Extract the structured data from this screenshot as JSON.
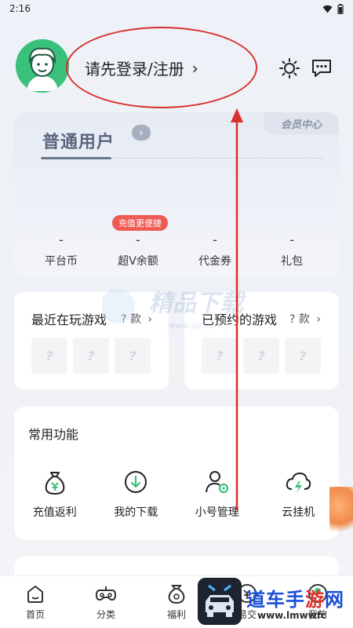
{
  "status_bar": {
    "time": "2:16"
  },
  "header": {
    "login_text": "请先登录/注册",
    "login_chevron": "›"
  },
  "member_card": {
    "level": "普通用户",
    "center_tab": "会员中心",
    "arrow": "›"
  },
  "recharge_badge": "充值更便捷",
  "stats": [
    {
      "value": "-",
      "label": "平台币"
    },
    {
      "value": "-",
      "label": "超V余额"
    },
    {
      "value": "-",
      "label": "代金券"
    },
    {
      "value": "-",
      "label": "礼包"
    }
  ],
  "recent_games": {
    "title": "最近在玩游戏",
    "count": "? 款",
    "chevron": "›"
  },
  "reserved_games": {
    "title": "已预约的游戏",
    "count": "? 款",
    "chevron": "›"
  },
  "slot_placeholder": "?",
  "watermark": {
    "text": "精品下载",
    "url": "www.jpj.com"
  },
  "functions": {
    "title": "常用功能",
    "items": [
      {
        "label": "充值返利",
        "icon": "money-bag-icon"
      },
      {
        "label": "我的下载",
        "icon": "download-icon"
      },
      {
        "label": "小号管理",
        "icon": "user-settings-icon"
      },
      {
        "label": "云挂机",
        "icon": "cloud-lightning-icon"
      }
    ]
  },
  "tabbar": [
    {
      "label": "首页",
      "icon": "home-icon"
    },
    {
      "label": "分类",
      "icon": "gamepad-icon"
    },
    {
      "label": "福利",
      "icon": "gift-bag-icon"
    },
    {
      "label": "易交",
      "icon": "trade-icon"
    },
    {
      "label": "我的",
      "icon": "profile-icon"
    }
  ],
  "overlay": {
    "brand_a": "道车手",
    "brand_b": "游",
    "brand_c": "网",
    "url": "www.lmwwfc"
  },
  "colors": {
    "accent_green": "#3ac07a",
    "annotation_red": "#d8302a",
    "badge_red": "#ef5a54"
  }
}
